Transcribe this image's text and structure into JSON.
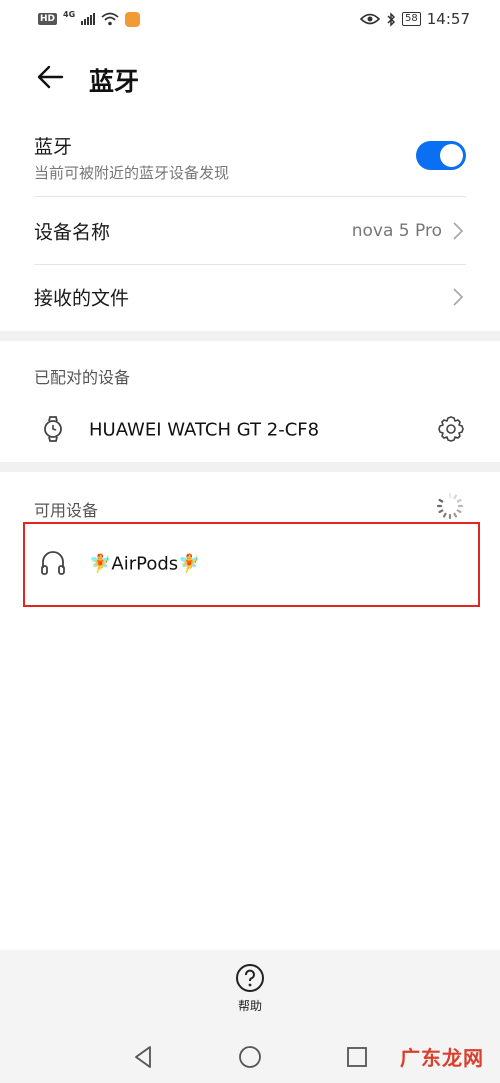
{
  "status_bar": {
    "hd": "HD",
    "network": "4G",
    "battery": "58",
    "time": "14:57"
  },
  "header": {
    "title": "蓝牙"
  },
  "bluetooth": {
    "label": "蓝牙",
    "subtitle": "当前可被附近的蓝牙设备发现",
    "enabled": true,
    "accent": "#0a6ff3"
  },
  "device_name": {
    "label": "设备名称",
    "value": "nova 5 Pro"
  },
  "received_files": {
    "label": "接收的文件"
  },
  "paired": {
    "title": "已配对的设备",
    "devices": [
      {
        "name": "HUAWEI WATCH GT 2-CF8",
        "icon": "watch-icon"
      }
    ]
  },
  "available": {
    "title": "可用设备",
    "devices": [
      {
        "name": "🧚AirPods🧚",
        "icon": "headphones-icon"
      }
    ]
  },
  "footer": {
    "help_label": "帮助"
  },
  "watermark": "广东龙网"
}
